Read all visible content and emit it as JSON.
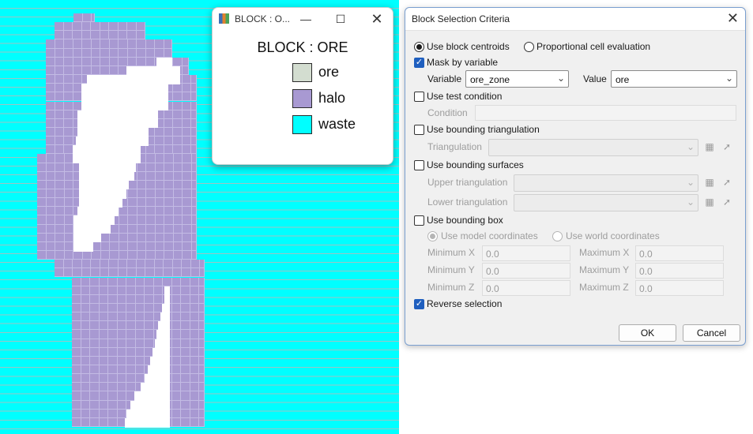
{
  "viewport": {
    "colors": {
      "background": "#00ffff",
      "halo": "#a899d2",
      "ore": "#ffffff"
    }
  },
  "legend_window": {
    "title": "BLOCK : O...",
    "icons": {
      "app": "app-icon",
      "minimize": "minimize-icon",
      "maximize": "maximize-icon",
      "close": "close-icon"
    },
    "legend_title": "BLOCK : ORE",
    "items": [
      {
        "label": "ore",
        "color": "#d3ddd0"
      },
      {
        "label": "halo",
        "color": "#a899d2"
      },
      {
        "label": "waste",
        "color": "#00ffff"
      }
    ]
  },
  "dialog": {
    "title": "Block Selection Criteria",
    "close_icon": "close-icon",
    "use_block_centroids": {
      "label": "Use block centroids",
      "selected": true
    },
    "proportional_cell": {
      "label": "Proportional cell evaluation",
      "selected": false
    },
    "mask_by_variable": {
      "label": "Mask by variable",
      "checked": true
    },
    "variable": {
      "label": "Variable",
      "value": "ore_zone"
    },
    "value": {
      "label": "Value",
      "value": "ore"
    },
    "use_test_condition": {
      "label": "Use test condition",
      "checked": false
    },
    "condition": {
      "label": "Condition",
      "value": ""
    },
    "use_bounding_triangulation": {
      "label": "Use bounding triangulation",
      "checked": false
    },
    "triangulation": {
      "label": "Triangulation",
      "value": ""
    },
    "use_bounding_surfaces": {
      "label": "Use bounding surfaces",
      "checked": false
    },
    "upper_triangulation": {
      "label": "Upper triangulation",
      "value": ""
    },
    "lower_triangulation": {
      "label": "Lower triangulation",
      "value": ""
    },
    "use_bounding_box": {
      "label": "Use bounding box",
      "checked": false
    },
    "use_model_coordinates": {
      "label": "Use model coordinates",
      "selected": true
    },
    "use_world_coordinates": {
      "label": "Use world coordinates",
      "selected": false
    },
    "minimum_x": {
      "label": "Minimum X",
      "value": "0.0"
    },
    "maximum_x": {
      "label": "Maximum X",
      "value": "0.0"
    },
    "minimum_y": {
      "label": "Minimum Y",
      "value": "0.0"
    },
    "maximum_y": {
      "label": "Maximum Y",
      "value": "0.0"
    },
    "minimum_z": {
      "label": "Minimum Z",
      "value": "0.0"
    },
    "maximum_z": {
      "label": "Maximum Z",
      "value": "0.0"
    },
    "reverse_selection": {
      "label": "Reverse selection",
      "checked": true
    },
    "ok": "OK",
    "cancel": "Cancel",
    "icons": {
      "folder": "folder-icon",
      "pick": "pick-arrow-icon",
      "dropdown": "chevron-down-icon"
    }
  }
}
